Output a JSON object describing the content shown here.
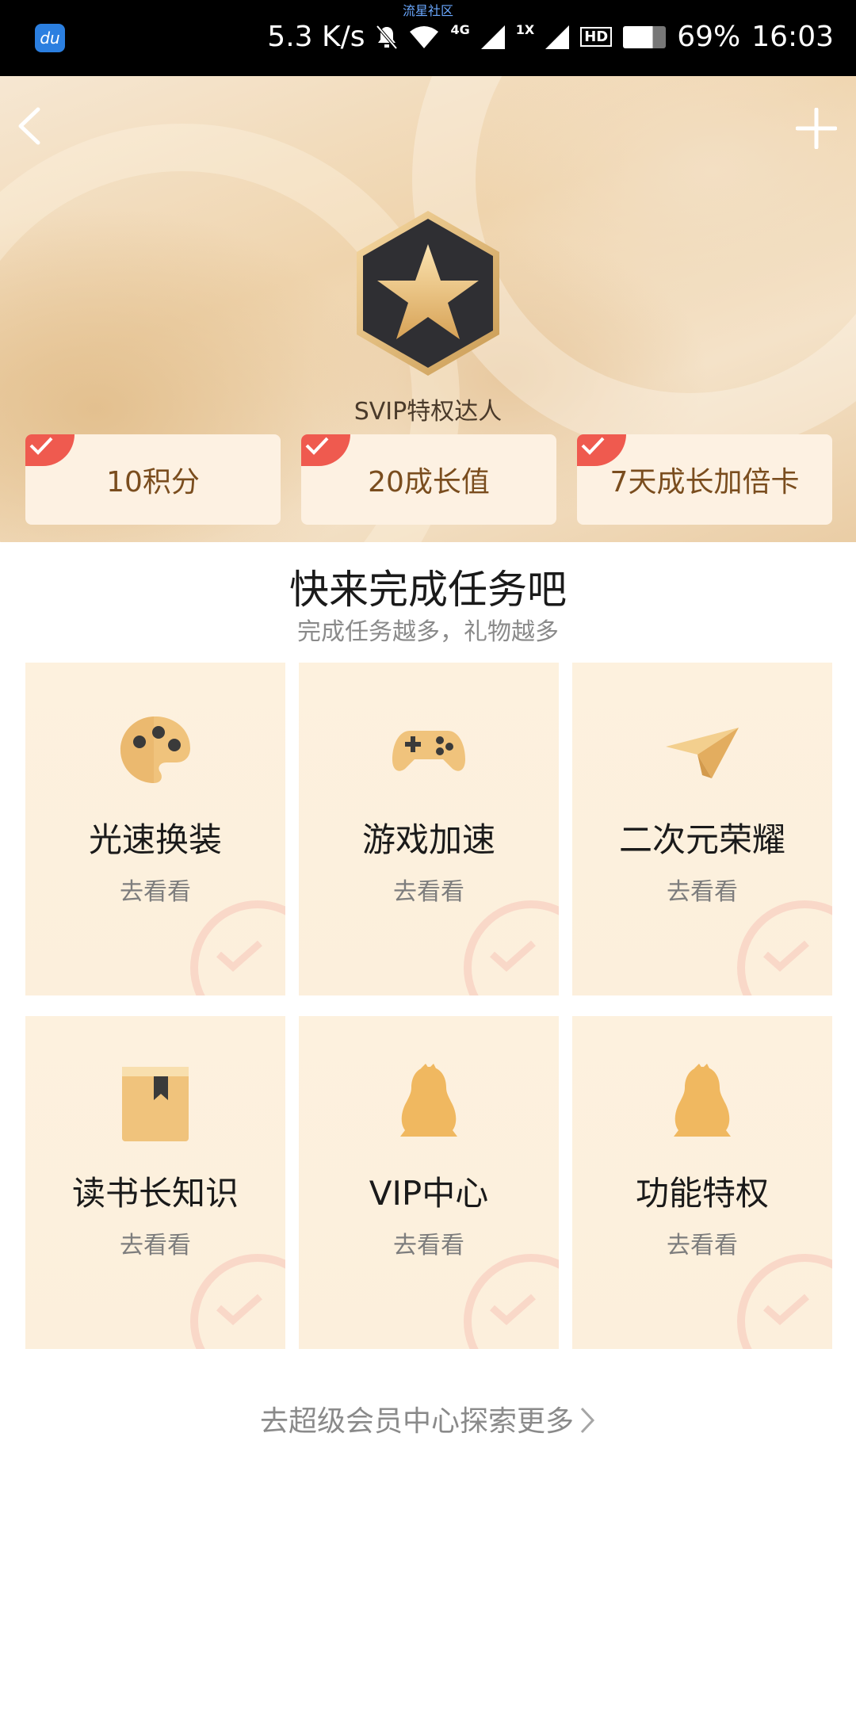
{
  "status_bar": {
    "app_icon_text": "du",
    "center_text": "流星社区",
    "speed": "5.3 K/s",
    "network": "4G",
    "sim_label": "1X",
    "hd_label": "HD",
    "battery": "69%",
    "time": "16:03"
  },
  "header": {
    "back_icon": "chevron-left-icon",
    "add_icon": "plus-icon"
  },
  "hero": {
    "badge_icon": "star-hexagon-badge-icon",
    "title": "SVIP特权达人",
    "rewards": [
      {
        "label": "10积分"
      },
      {
        "label": "20成长值"
      },
      {
        "label": "7天成长加倍卡"
      }
    ]
  },
  "tasks": {
    "title": "快来完成任务吧",
    "subtitle": "完成任务越多，礼物越多",
    "items": [
      {
        "name": "光速换装",
        "action": "去看看",
        "icon": "palette-icon"
      },
      {
        "name": "游戏加速",
        "action": "去看看",
        "icon": "gamepad-icon"
      },
      {
        "name": "二次元荣耀",
        "action": "去看看",
        "icon": "paper-plane-icon"
      },
      {
        "name": "读书长知识",
        "action": "去看看",
        "icon": "book-icon"
      },
      {
        "name": "VIP中心",
        "action": "去看看",
        "icon": "penguin-icon"
      },
      {
        "name": "功能特权",
        "action": "去看看",
        "icon": "penguin-icon"
      }
    ]
  },
  "footer": {
    "explore_link": "去超级会员中心探索更多"
  },
  "colors": {
    "accent_gold": "#e9b35f",
    "check_red": "#ef5a4f",
    "reward_text": "#7a4d1e",
    "card_bg": "#fdf1de"
  }
}
